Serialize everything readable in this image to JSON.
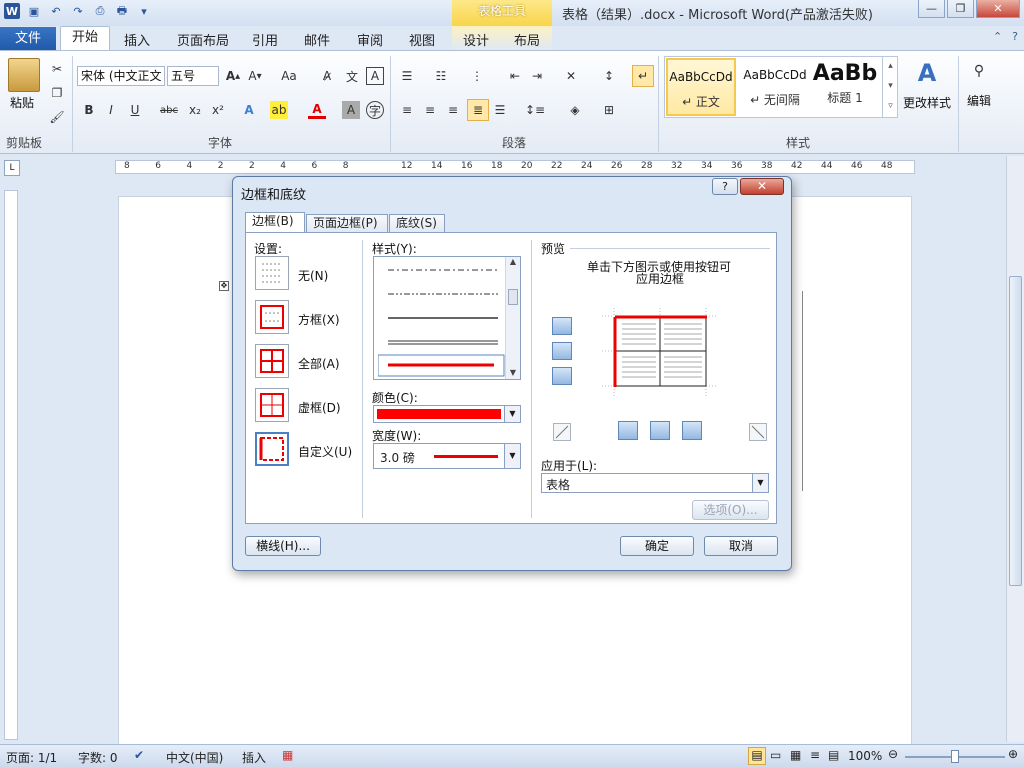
{
  "titlebar": {
    "doc_title": "表格（结果）.docx  -  Microsoft Word(产品激活失败)",
    "context_tab": "表格工具",
    "logo": "W",
    "window_buttons": [
      "—",
      "❐",
      "✕"
    ]
  },
  "tabs": {
    "file": "文件",
    "items": [
      "开始",
      "插入",
      "页面布局",
      "引用",
      "邮件",
      "审阅",
      "视图"
    ],
    "context_items": [
      "设计",
      "布局"
    ]
  },
  "ribbon": {
    "clipboard": {
      "paste": "粘贴",
      "group": "剪贴板"
    },
    "font": {
      "name": "宋体 (中文正文",
      "size": "五号",
      "group": "字体"
    },
    "paragraph": {
      "group": "段落"
    },
    "styles": {
      "group": "样式",
      "items": [
        {
          "sample": "AaBbCcDd",
          "label": "↵ 正文"
        },
        {
          "sample": "AaBbCcDd",
          "label": "↵ 无间隔"
        },
        {
          "sample": "AaBb",
          "label": "标题 1"
        }
      ],
      "change": "更改样式"
    },
    "editing": {
      "label": "编辑"
    }
  },
  "ruler": {
    "left_ticks": [
      "8",
      "6",
      "4",
      "2",
      "2",
      "4",
      "6",
      "8"
    ],
    "right_ticks": [
      "12",
      "14",
      "16",
      "18",
      "20",
      "22",
      "24",
      "26",
      "28",
      "32",
      "34",
      "36",
      "38",
      "42",
      "44",
      "46",
      "48"
    ]
  },
  "dialog": {
    "title": "边框和底纹",
    "tabs": [
      "边框(B)",
      "页面边框(P)",
      "底纹(S)"
    ],
    "settings_label": "设置:",
    "settings": [
      "无(N)",
      "方框(X)",
      "全部(A)",
      "虚框(D)",
      "自定义(U)"
    ],
    "style_label": "样式(Y):",
    "color_label": "颜色(C):",
    "color_value": "#ff0000",
    "width_label": "宽度(W):",
    "width_value": "3.0 磅",
    "preview_label": "预览",
    "preview_hint_1": "单击下方图示或使用按钮可",
    "preview_hint_2": "应用边框",
    "apply_label": "应用于(L):",
    "apply_value": "表格",
    "options_btn": "选项(O)...",
    "hline_btn": "横线(H)...",
    "ok_btn": "确定",
    "cancel_btn": "取消"
  },
  "status": {
    "page": "页面: 1/1",
    "words": "字数: 0",
    "lang": "中文(中国)",
    "mode": "插入",
    "zoom": "100%"
  }
}
